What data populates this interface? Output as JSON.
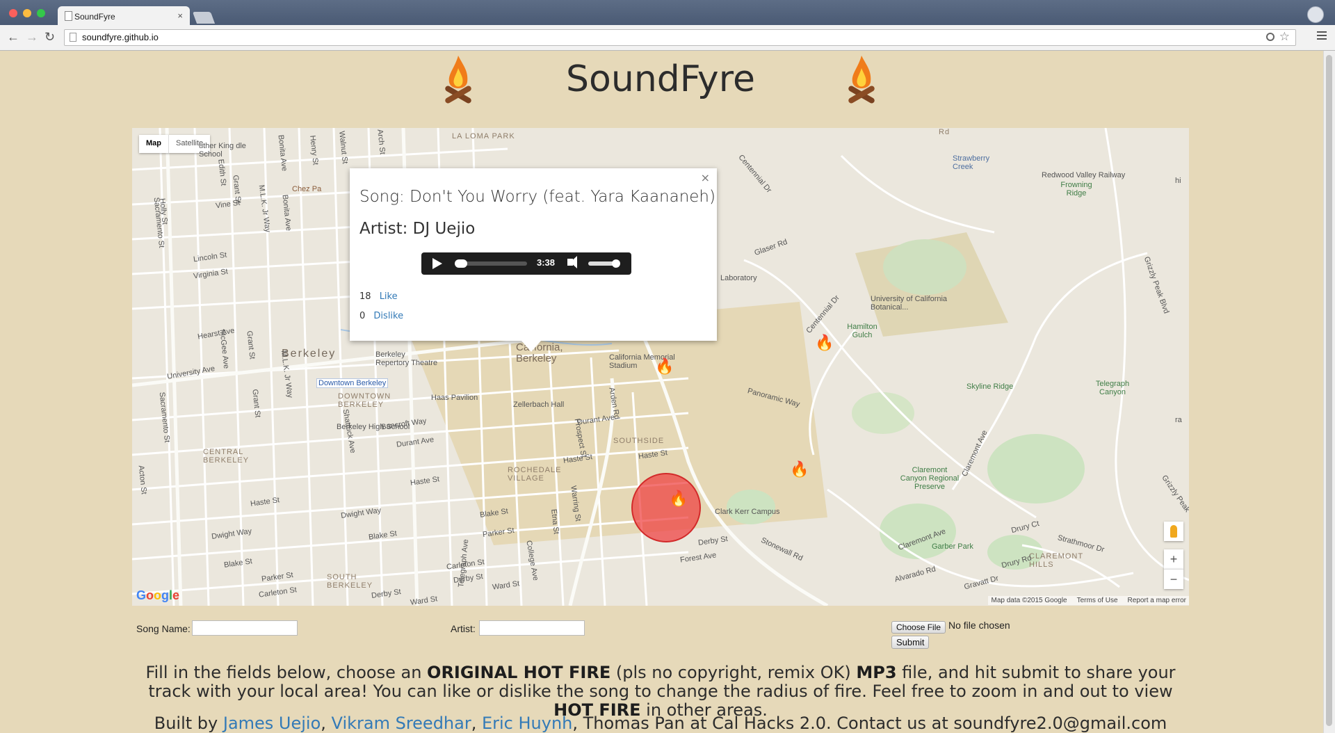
{
  "browser": {
    "tab_title": "SoundFyre",
    "tab_close": "×",
    "url": "soundfyre.github.io"
  },
  "header": {
    "title": "SoundFyre"
  },
  "map": {
    "type_buttons": [
      "Map",
      "Satellite"
    ],
    "labels": {
      "berkeley": "Berkeley",
      "downtown_berkeley": "DOWNTOWN BERKELEY",
      "central_berkeley": "CENTRAL BERKELEY",
      "south_berkeley": "SOUTH BERKELEY",
      "southside": "SOUTHSIDE",
      "rochedale_village": "ROCHEDALE VILLAGE",
      "claremont_hills": "CLAREMONT HILLS",
      "uc_berkeley": "California, Berkeley",
      "memorial_stadium": "California Memorial Stadium",
      "berkeley_rep": "Berkeley Repertory Theatre",
      "downtown_bart": "Downtown Berkeley",
      "haas": "Haas Pavilion",
      "zellerbach": "Zellerbach Hall",
      "berkeley_high": "Berkeley High School",
      "clark_kerr": "Clark Kerr Campus",
      "botanical": "University of California Botanical...",
      "hamilton_gulch": "Hamilton Gulch",
      "skyline": "Skyline Ridge",
      "telegraph_canyon": "Telegraph Canyon",
      "strawberry_creek": "Strawberry Creek",
      "redwood_railway": "Redwood Valley Railway",
      "frowning_ridge": "Frowning Ridge",
      "claremont_preserve": "Claremont Canyon Regional Preserve",
      "garber_park": "Garber Park",
      "laboratory": "Laboratory",
      "panoramic": "Panoramic Way",
      "mlk_school": "uther King dle School",
      "chez_pa": "Chez Pa",
      "la_loma_park": "LA LOMA PARK",
      "university_ave": "University Ave",
      "hearst_ave": "Hearst Ave",
      "bancroft_way": "Bancroft Way",
      "durant_ave": "Durant Ave",
      "durant_ave_2": "Durant Ave",
      "haste_st": "Haste St",
      "haste_st_2": "Haste St",
      "haste_st_3": "Haste St",
      "haste_st_4": "Haste St",
      "dwight_way": "Dwight Way",
      "dwight_way_2": "Dwight Way",
      "blake_st": "Blake St",
      "blake_st_2": "Blake St",
      "blake_st_3": "Blake St",
      "parker_st": "Parker St",
      "parker_st_2": "Parker St",
      "carleton_st": "Carleton St",
      "carleton_st_2": "Carleton St",
      "derby_st": "Derby St",
      "derby_st_2": "Derby St",
      "derby_st_3": "Derby St",
      "ward_st": "Ward St",
      "ward_st_2": "Ward St",
      "forest_ave": "Forest Ave",
      "lincoln_st": "Lincoln St",
      "virginia_st": "Virginia St",
      "vine_st": "Vine St",
      "mlk_jr_way": "M.L.K. Jr Way",
      "mlk_jr_way_2": "M.L.K. Jr Way",
      "shattuck_ave": "Shattuck Ave",
      "telegraph_ave": "Telegraph Ave",
      "college_ave": "College Ave",
      "prospect_st": "Prospect St",
      "warring_st": "Warring St",
      "arden_rd": "Arden Rd",
      "glaser_rd": "Glaser Rd",
      "centennial_dr": "Centennial Dr",
      "centennial_dr_2": "Centennial Dr",
      "claremont_ave": "Claremont Ave",
      "claremont_ave_2": "Claremont Ave",
      "grizzly_peak_blvd": "Grizzly Peak Blvd",
      "grizzly_peak_2": "Grizzly Peak",
      "drury_ct": "Drury Ct",
      "drury_rd": "Drury Rd",
      "strathmoor_dr": "Strathmoor Dr",
      "alvarado_rd": "Alvarado Rd",
      "gravatt_dr": "Gravatt Dr",
      "stonewall_rd": "Stonewall Rd",
      "sacramento_st": "Sacramento St",
      "sacramento_st_2": "Sacramento St",
      "grant_st": "Grant St",
      "grant_st_2": "Grant St",
      "grant_st_3": "Grant St",
      "mcgee_ave": "McGee Ave",
      "bonita_ave": "Bonita Ave",
      "bonita_ave_2": "Bonita Ave",
      "holly_st": "Holly St",
      "acton_st": "Acton St",
      "edith_st": "Edith St",
      "henry_st": "Henry St",
      "walnut_st": "Walnut St",
      "arch_st": "Arch St",
      "etna_st": "Etna St",
      "rd_label": "Rd",
      "hi_label": "hi",
      "ra_label": "ra"
    },
    "controls": {
      "zoom_in": "+",
      "zoom_out": "−"
    },
    "google_logo": "Google",
    "footer": {
      "map_data": "Map data ©2015 Google",
      "terms": "Terms of Use",
      "report": "Report a map error"
    },
    "info_window": {
      "close": "×",
      "song": "Song: Don't You Worry (feat. Yara Kaananeh)",
      "artist": "Artist: DJ Uejio",
      "player": {
        "time": "3:38",
        "progress": 0,
        "volume": 1.0
      },
      "likes": "18",
      "like_label": "Like",
      "dislikes": "0",
      "dislike_label": "Dislike"
    }
  },
  "form": {
    "song_label": "Song Name:",
    "song_value": "",
    "artist_label": "Artist:",
    "artist_value": "",
    "file_button": "Choose File",
    "file_status": "No file chosen",
    "submit": "Submit"
  },
  "description": {
    "part1": "Fill in the fields below, choose an ",
    "bold1": "ORIGINAL HOT FIRE",
    "part2": " (pls no copyright, remix OK) ",
    "bold2": "MP3",
    "part3": " file, and hit submit to share your track with your local area! You can like or dislike the song to change the radius of fire. Feel free to zoom in and out to view ",
    "bold3": "HOT FIRE",
    "part4": " in other areas."
  },
  "credits": {
    "prefix": "Built by ",
    "author1": "James Uejio",
    "sep1": ", ",
    "author2": "Vikram Sreedhar",
    "sep2": ", ",
    "author3": "Eric Huynh",
    "suffix": ", Thomas Pan at Cal Hacks 2.0. Contact us at soundfyre2.0@gmail.com"
  },
  "colors": {
    "page_bg": "#e6d9b9",
    "link": "#337ab7",
    "fire_circle": "#ef3e3e"
  }
}
